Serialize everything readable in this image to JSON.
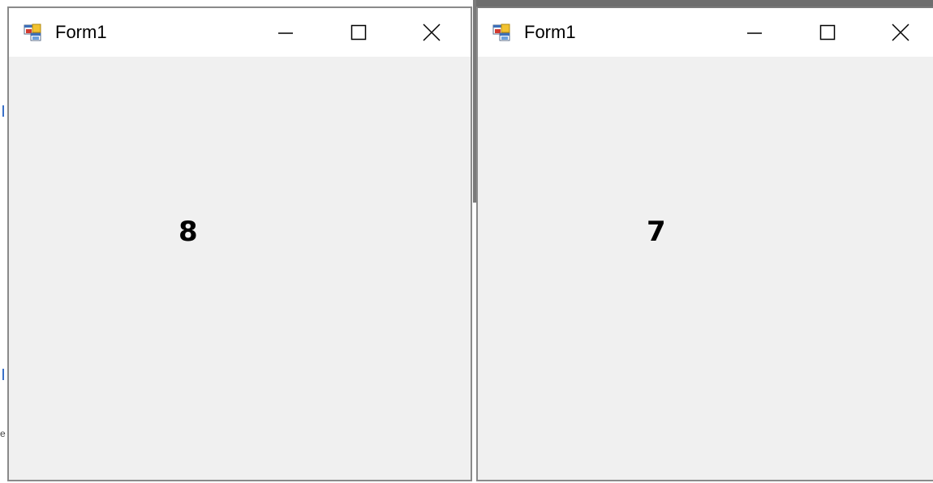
{
  "windows": [
    {
      "title": "Form1",
      "icon": "windows-form-icon",
      "controls": {
        "minimize": "minimize-icon",
        "maximize": "maximize-icon",
        "close": "close-icon"
      },
      "label_value": "8"
    },
    {
      "title": "Form1",
      "icon": "windows-form-icon",
      "controls": {
        "minimize": "minimize-icon",
        "maximize": "maximize-icon",
        "close": "close-icon"
      },
      "label_value": "7"
    }
  ],
  "colors": {
    "titlebar_bg": "#ffffff",
    "client_bg": "#f0f0f0",
    "border": "#8a8a8a",
    "text": "#000000"
  }
}
